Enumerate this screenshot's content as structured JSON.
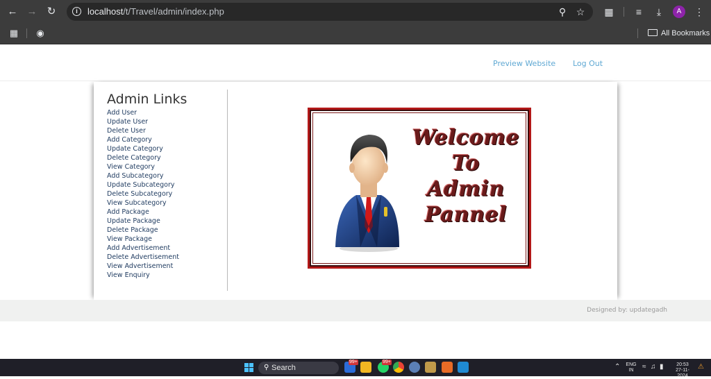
{
  "browser": {
    "url_host": "localhost",
    "url_path": "/t/Travel/admin/index.php",
    "profile_initial": "A",
    "bookmarks_label": "All Bookmarks"
  },
  "header": {
    "preview_label": "Preview Website",
    "logout_label": "Log Out"
  },
  "sidebar": {
    "title": "Admin Links",
    "links": [
      "Add User",
      "Update User",
      "Delete User",
      "Add Category",
      "Update Category",
      "Delete Category",
      "View Category",
      "Add Subcategory",
      "Update Subcategory",
      "Delete Subcategory",
      "View Subcategory",
      "Add Package",
      "Update Package",
      "Delete Package",
      "View Package",
      "Add Advertisement",
      "Delete Advertisement",
      "View Advertisement",
      "View Enquiry"
    ]
  },
  "welcome_banner": {
    "line1": "Welcome",
    "line2": "To",
    "line3": "Admin",
    "line4": "Pannel",
    "border_color": "#b21818"
  },
  "footer": {
    "credit": "Designed by: updategadh"
  },
  "taskbar": {
    "search_label": "Search",
    "badge_1": "99+",
    "badge_2": "99+",
    "lang_line1": "ENG",
    "lang_line2": "IN",
    "time": "20:53",
    "date": "27-11-2024"
  }
}
